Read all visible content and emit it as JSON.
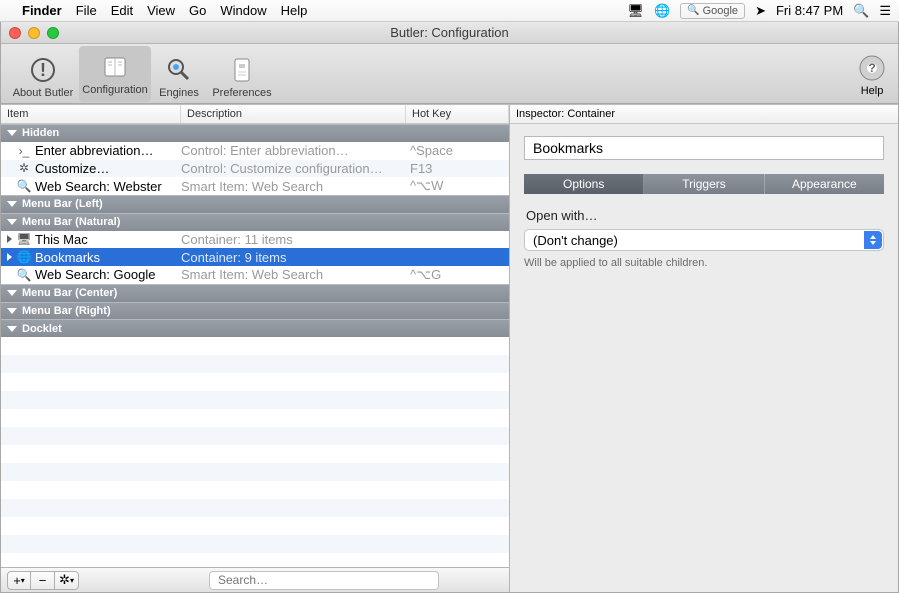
{
  "menubar": {
    "app": "Finder",
    "items": [
      "File",
      "Edit",
      "View",
      "Go",
      "Window",
      "Help"
    ],
    "search_placeholder": "Google",
    "clock": "Fri 8:47 PM"
  },
  "window": {
    "title": "Butler: Configuration"
  },
  "toolbar": {
    "about": "About Butler",
    "configuration": "Configuration",
    "engines": "Engines",
    "preferences": "Preferences",
    "help": "Help"
  },
  "columns": {
    "item": "Item",
    "description": "Description",
    "hotkey": "Hot Key"
  },
  "groups": {
    "hidden": "Hidden",
    "menubar_left": "Menu Bar (Left)",
    "menubar_natural": "Menu Bar (Natural)",
    "menubar_center": "Menu Bar (Center)",
    "menubar_right": "Menu Bar (Right)",
    "docklet": "Docklet"
  },
  "rows": {
    "enter_abbrev": {
      "label": "Enter abbreviation…",
      "desc": "Control: Enter abbreviation…",
      "hot": "^Space"
    },
    "customize": {
      "label": "Customize…",
      "desc": "Control: Customize configuration…",
      "hot": "F13"
    },
    "webster": {
      "label": "Web Search: Webster",
      "desc": "Smart Item: Web Search",
      "hot": "^⌥W"
    },
    "thismac": {
      "label": "This Mac",
      "desc": "Container: 11 items",
      "hot": ""
    },
    "bookmarks": {
      "label": "Bookmarks",
      "desc": "Container: 9 items",
      "hot": ""
    },
    "google": {
      "label": "Web Search: Google",
      "desc": "Smart Item: Web Search",
      "hot": "^⌥G"
    }
  },
  "bottombar": {
    "search_placeholder": "Search…"
  },
  "inspector": {
    "header": "Inspector: Container",
    "name": "Bookmarks",
    "tabs": {
      "options": "Options",
      "triggers": "Triggers",
      "appearance": "Appearance"
    },
    "openwith_label": "Open with…",
    "openwith_value": "(Don't change)",
    "hint": "Will be applied to all suitable children."
  }
}
